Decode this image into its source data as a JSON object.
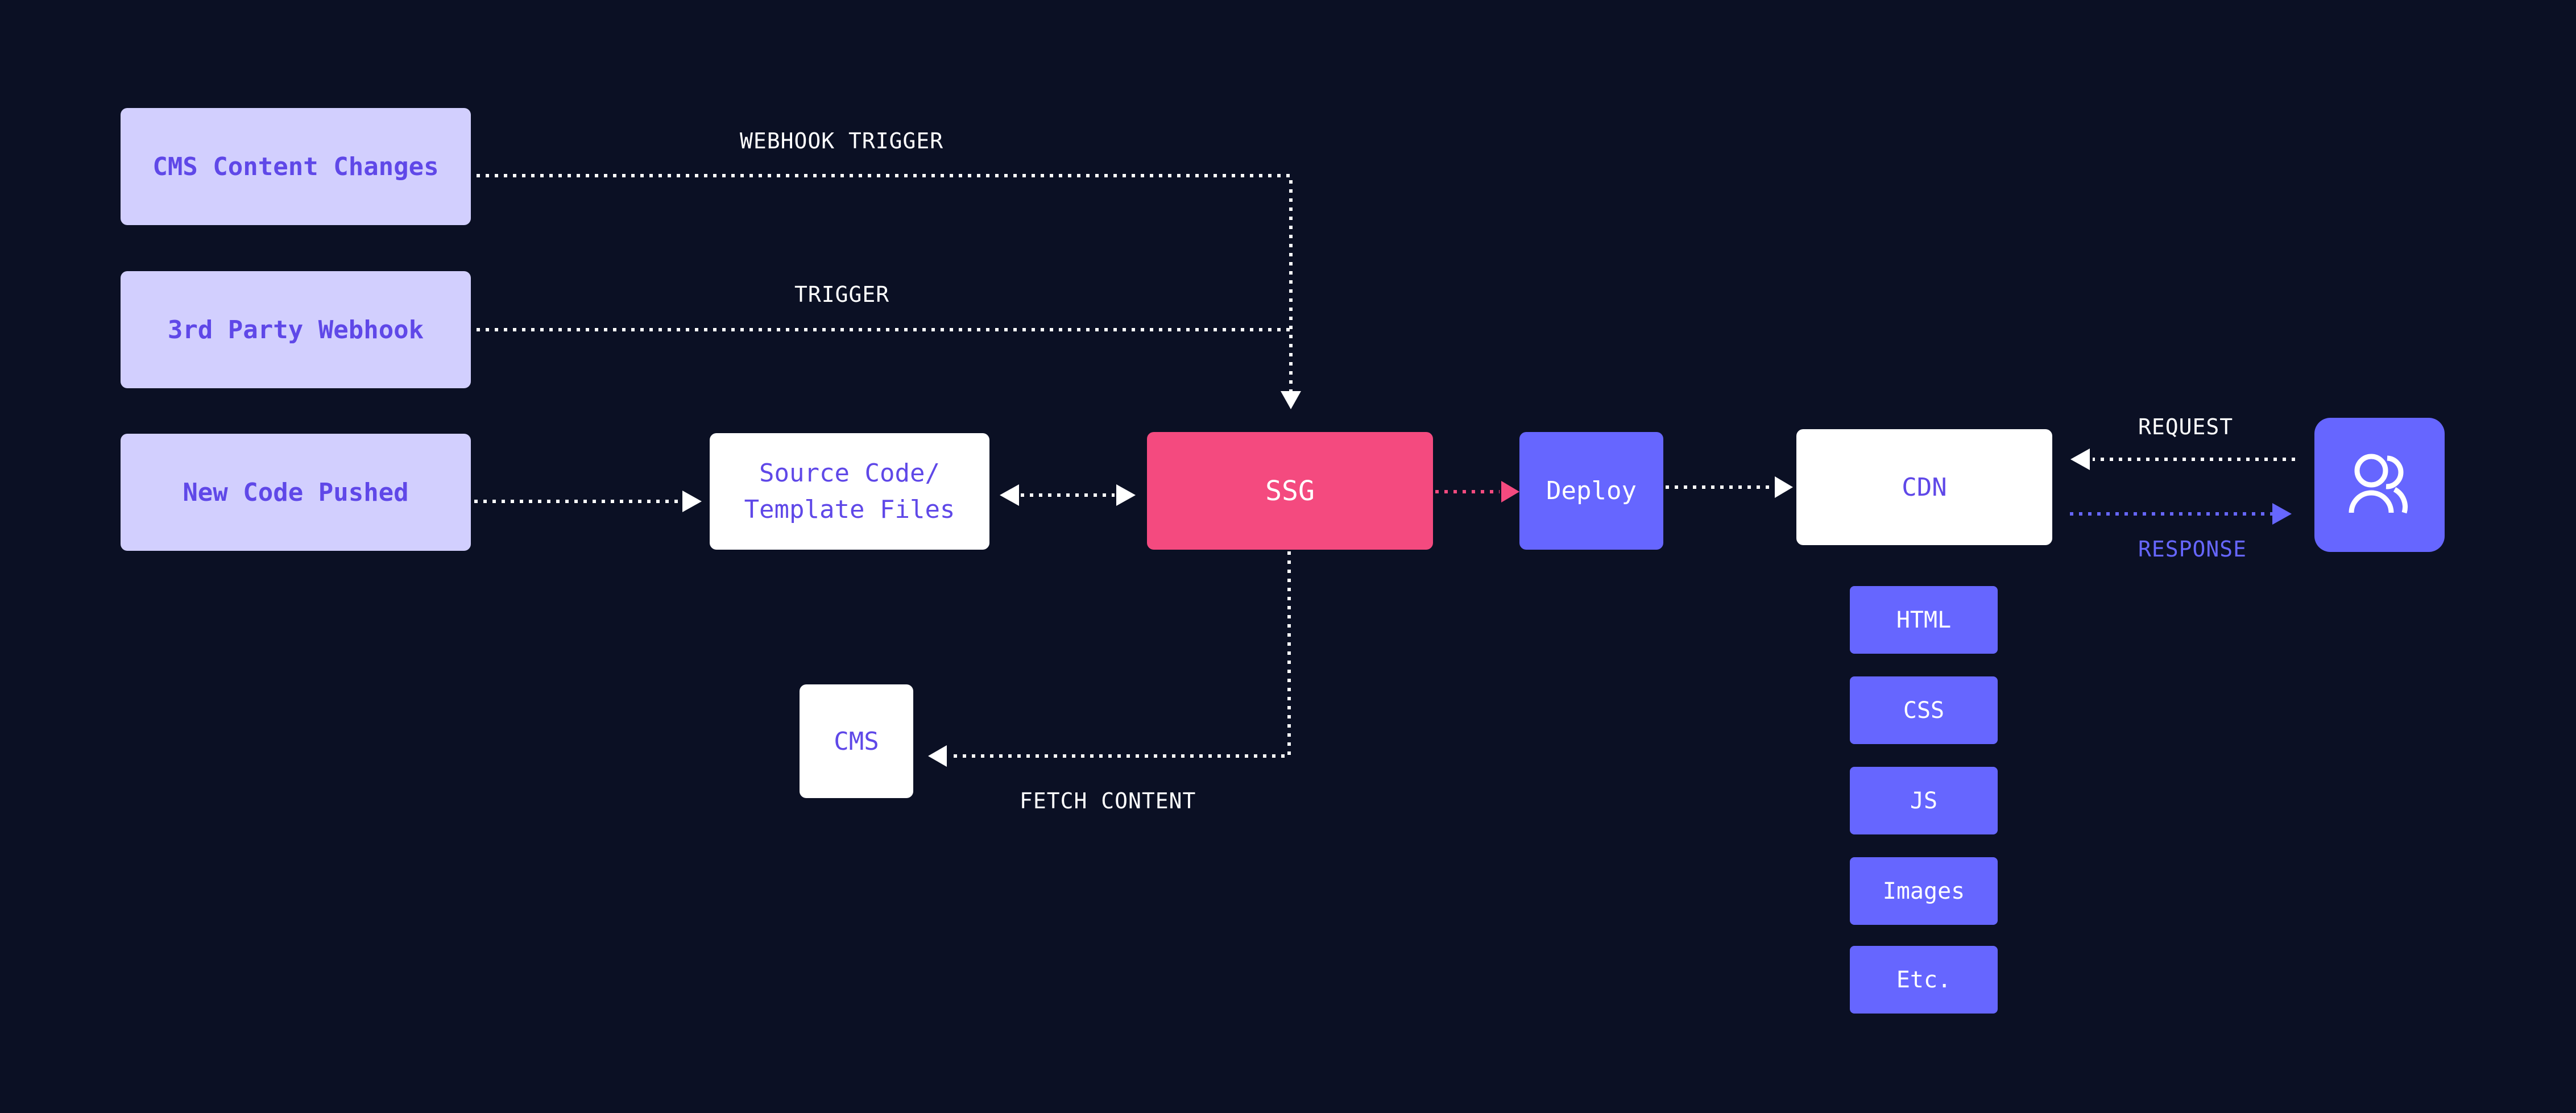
{
  "colors": {
    "background": "#0b1024",
    "trigger_fill": "#d2cffe",
    "trigger_text": "#5f48e8",
    "ssg": "#f44a7f",
    "accent": "#6666ff",
    "white": "#ffffff"
  },
  "triggers": [
    {
      "label": "CMS Content Changes"
    },
    {
      "label": "3rd Party Webhook"
    },
    {
      "label": "New Code Pushed"
    }
  ],
  "nodes": {
    "source": {
      "line1": "Source Code/",
      "line2": "Template Files"
    },
    "ssg": {
      "label": "SSG"
    },
    "deploy": {
      "label": "Deploy"
    },
    "cdn": {
      "label": "CDN"
    },
    "cms": {
      "label": "CMS"
    },
    "user": {
      "icon": "users-icon"
    }
  },
  "assets": [
    "HTML",
    "CSS",
    "JS",
    "Images",
    "Etc."
  ],
  "edge_labels": {
    "webhook_trigger": "WEBHOOK TRIGGER",
    "trigger": "TRIGGER",
    "fetch_content": "FETCH CONTENT",
    "request": "REQUEST",
    "response": "RESPONSE"
  }
}
